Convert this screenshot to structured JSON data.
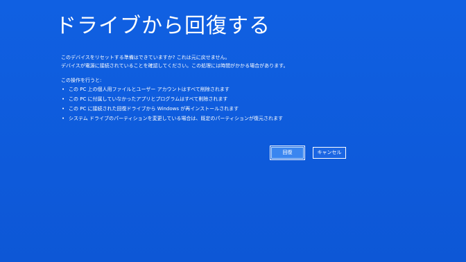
{
  "page": {
    "title": "ドライブから回復する"
  },
  "intro": {
    "line1": "このデバイスをリセットする準備はできていますか? これは元に戻せません。",
    "line2": "デバイスが電源に接続されていることを確認してください。この処理には時間がかかる場合があります。"
  },
  "actions": {
    "heading": "この操作を行うと:",
    "bullet": "•",
    "items": [
      "この PC 上の個人用ファイルとユーザー アカウントはすべて削除されます",
      "この PC に付属していなかったアプリとプログラムはすべて削除されます",
      "この PC に接続された回復ドライブから Windows が再インストールされます",
      "システム ドライブのパーティションを変更している場合は、既定のパーティションが復元されます"
    ]
  },
  "buttons": {
    "recover_label": "回復",
    "cancel_label": "キャンセル"
  },
  "colors": {
    "background": "#0f5bdd",
    "text": "#ffffff",
    "focused_button": "#3a86f0"
  }
}
